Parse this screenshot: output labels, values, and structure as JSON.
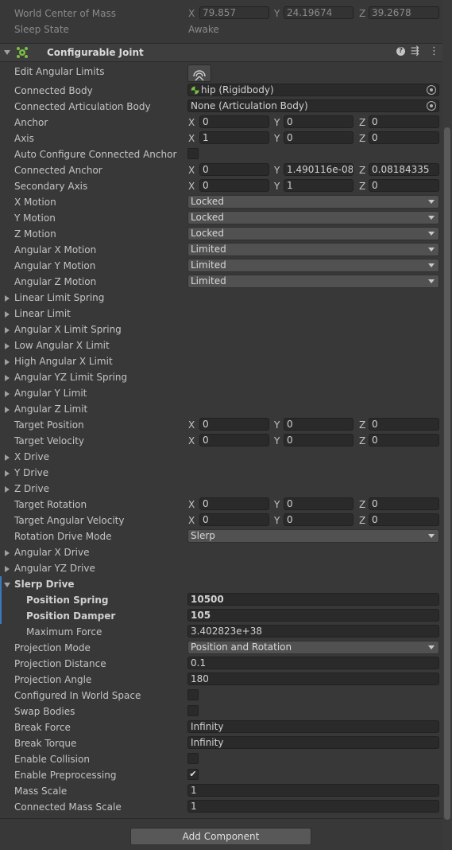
{
  "top": {
    "world_center_label": "World Center of Mass",
    "wc_x": "79.857",
    "wc_y": "24.19674",
    "wc_z": "39.2678",
    "sleep_label": "Sleep State",
    "sleep_value": "Awake"
  },
  "component": {
    "title": "Configurable Joint"
  },
  "axes": {
    "x": "X",
    "y": "Y",
    "z": "Z"
  },
  "rows": {
    "edit_angular_limits": "Edit Angular Limits",
    "connected_body": "Connected Body",
    "connected_body_value": "hip (Rigidbody)",
    "connected_articulation": "Connected Articulation Body",
    "connected_articulation_value": "None (Articulation Body)",
    "anchor": "Anchor",
    "anchor_x": "0",
    "anchor_y": "0",
    "anchor_z": "0",
    "axis": "Axis",
    "axis_x": "1",
    "axis_y": "0",
    "axis_z": "0",
    "auto_configure": "Auto Configure Connected Anchor",
    "connected_anchor": "Connected Anchor",
    "ca_x": "0",
    "ca_y": "1.490116e-08",
    "ca_z": "0.08184335",
    "secondary_axis": "Secondary Axis",
    "sa_x": "0",
    "sa_y": "1",
    "sa_z": "0",
    "x_motion": "X Motion",
    "x_motion_value": "Locked",
    "y_motion": "Y Motion",
    "y_motion_value": "Locked",
    "z_motion": "Z Motion",
    "z_motion_value": "Locked",
    "ang_x_motion": "Angular X Motion",
    "ang_x_motion_value": "Limited",
    "ang_y_motion": "Angular Y Motion",
    "ang_y_motion_value": "Limited",
    "ang_z_motion": "Angular Z Motion",
    "ang_z_motion_value": "Limited",
    "linear_limit_spring": "Linear Limit Spring",
    "linear_limit": "Linear Limit",
    "angular_x_limit_spring": "Angular X Limit Spring",
    "low_angular_x_limit": "Low Angular X Limit",
    "high_angular_x_limit": "High Angular X Limit",
    "angular_yz_limit_spring": "Angular YZ Limit Spring",
    "angular_y_limit": "Angular Y Limit",
    "angular_z_limit": "Angular Z Limit",
    "target_position": "Target Position",
    "tp_x": "0",
    "tp_y": "0",
    "tp_z": "0",
    "target_velocity": "Target Velocity",
    "tv_x": "0",
    "tv_y": "0",
    "tv_z": "0",
    "x_drive": "X Drive",
    "y_drive": "Y Drive",
    "z_drive": "Z Drive",
    "target_rotation": "Target Rotation",
    "tr_x": "0",
    "tr_y": "0",
    "tr_z": "0",
    "target_angular_velocity": "Target Angular Velocity",
    "tav_x": "0",
    "tav_y": "0",
    "tav_z": "0",
    "rotation_drive_mode": "Rotation Drive Mode",
    "rotation_drive_mode_value": "Slerp",
    "angular_x_drive": "Angular X Drive",
    "angular_yz_drive": "Angular YZ Drive",
    "slerp_drive": "Slerp Drive",
    "position_spring": "Position Spring",
    "position_spring_value": "10500",
    "position_damper": "Position Damper",
    "position_damper_value": "105",
    "maximum_force": "Maximum Force",
    "maximum_force_value": "3.402823e+38",
    "projection_mode": "Projection Mode",
    "projection_mode_value": "Position and Rotation",
    "projection_distance": "Projection Distance",
    "projection_distance_value": "0.1",
    "projection_angle": "Projection Angle",
    "projection_angle_value": "180",
    "configured_world_space": "Configured In World Space",
    "swap_bodies": "Swap Bodies",
    "break_force": "Break Force",
    "break_force_value": "Infinity",
    "break_torque": "Break Torque",
    "break_torque_value": "Infinity",
    "enable_collision": "Enable Collision",
    "enable_preprocessing": "Enable Preprocessing",
    "mass_scale": "Mass Scale",
    "mass_scale_value": "1",
    "connected_mass_scale": "Connected Mass Scale",
    "connected_mass_scale_value": "1"
  },
  "checkboxes": {
    "auto_configure": false,
    "configured_world_space": false,
    "swap_bodies": false,
    "enable_collision": false,
    "enable_preprocessing": true
  },
  "add_component": "Add Component",
  "icons": [
    "joint-component-icon",
    "help-icon",
    "settings-icon",
    "more-icon",
    "edit-angular-limits-icon",
    "rigidbody-icon",
    "object-picker-icon"
  ]
}
